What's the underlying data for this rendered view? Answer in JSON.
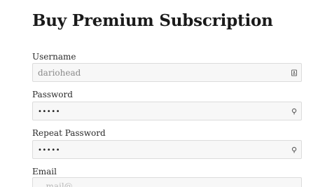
{
  "page": {
    "title": "Buy Premium Subscription"
  },
  "form": {
    "username": {
      "label": "Username",
      "value": "dariohead",
      "icon": "contact-card-icon"
    },
    "password": {
      "label": "Password",
      "value": "•••••",
      "icon": "key-icon"
    },
    "repeat_password": {
      "label": "Repeat Password",
      "value": "•••••",
      "icon": "key-icon"
    },
    "email": {
      "label": "Email",
      "value": "...mail@..."
    }
  }
}
